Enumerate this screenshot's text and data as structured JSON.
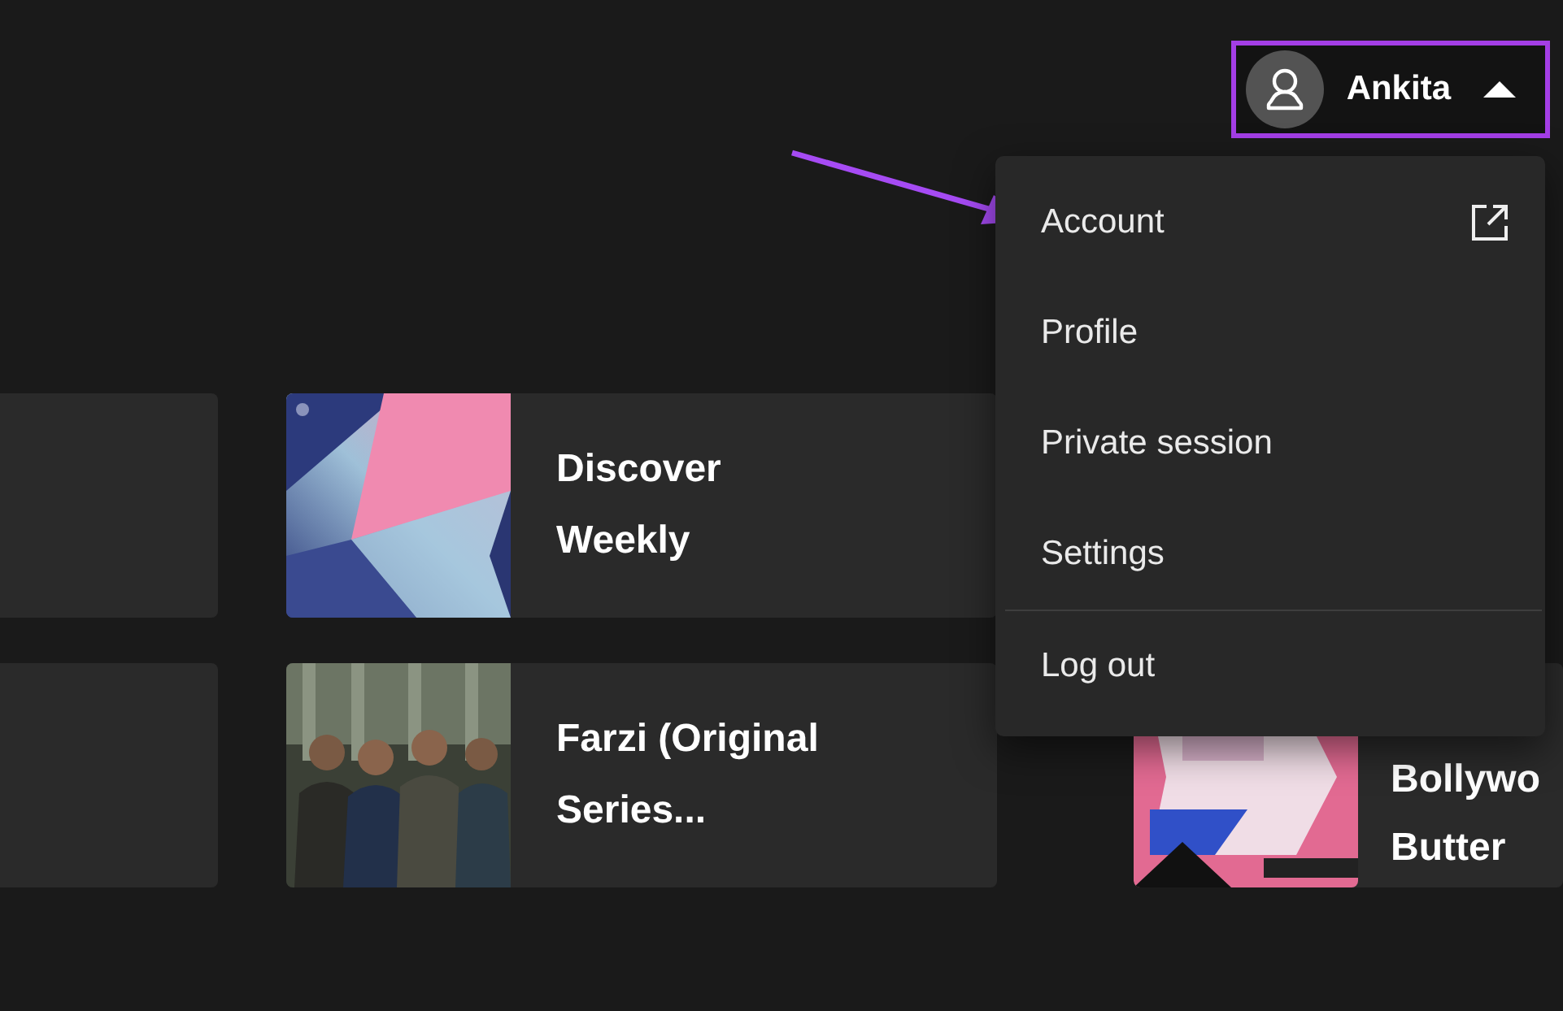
{
  "user_button": {
    "name": "Ankita",
    "expanded": true
  },
  "user_menu": [
    {
      "label": "Account",
      "external": true,
      "separated": false
    },
    {
      "label": "Profile",
      "external": false,
      "separated": false
    },
    {
      "label": "Private session",
      "external": false,
      "separated": false
    },
    {
      "label": "Settings",
      "external": false,
      "separated": false
    },
    {
      "label": "Log out",
      "external": false,
      "separated": true
    }
  ],
  "cards": [
    {
      "kind": "blank"
    },
    {
      "kind": "item",
      "title_lines": [
        "Discover",
        "Weekly"
      ]
    },
    {
      "kind": "hidden"
    },
    {
      "kind": "blank"
    },
    {
      "kind": "item",
      "title_lines": [
        "Farzi (Original",
        "Series..."
      ]
    },
    {
      "kind": "item",
      "title_lines": [
        "Bollywo",
        "Butter"
      ]
    }
  ]
}
